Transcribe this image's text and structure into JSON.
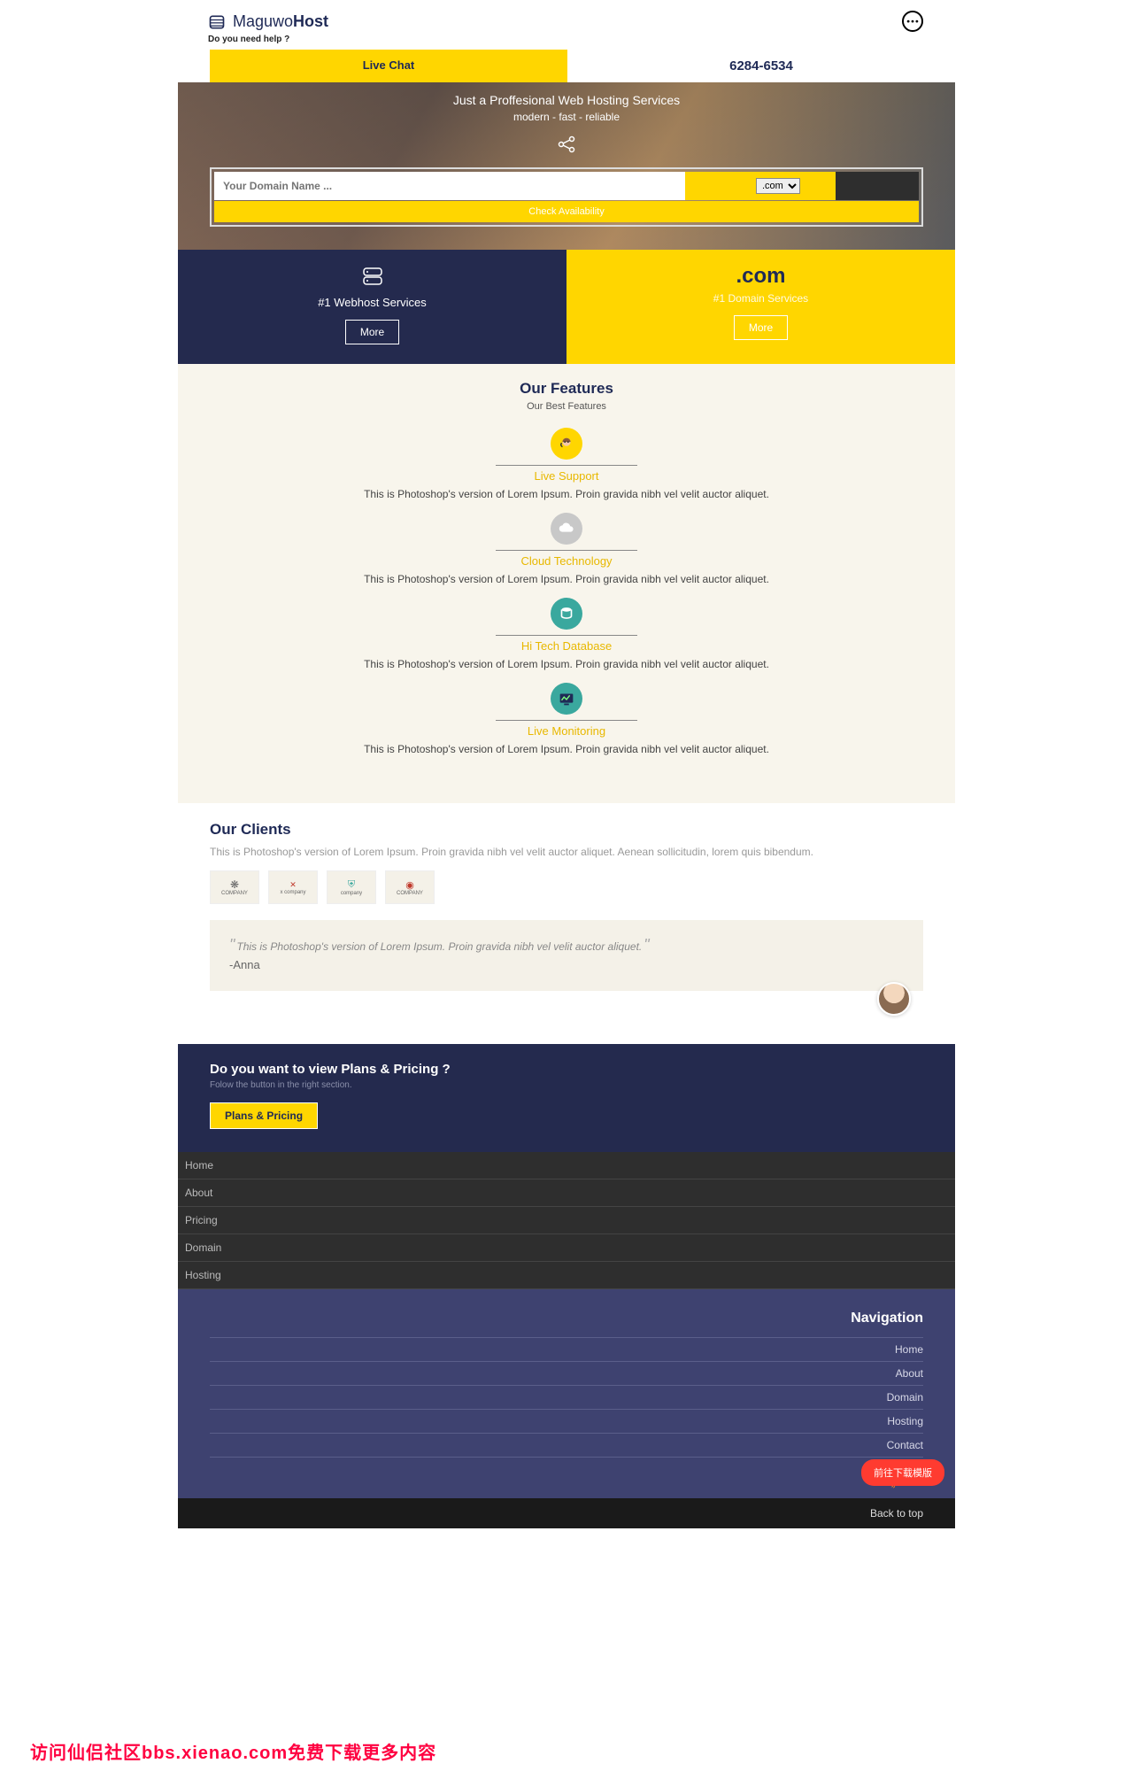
{
  "brand": {
    "prefix": "Maguwo",
    "suffix": "Host"
  },
  "help": "Do you need help ?",
  "livechat": "Live Chat",
  "phone": "6284-6534",
  "hero": {
    "title": "Just a Proffesional Web Hosting Services",
    "sub": "modern - fast - reliable",
    "placeholder": "Your Domain Name ...",
    "tld": ".com",
    "check": "Check Availability"
  },
  "promo": {
    "p1": {
      "label": "#1 Webhost Services",
      "btn": "More"
    },
    "p2": {
      "big": ".com",
      "label": "#1 Domain Services",
      "btn": "More"
    }
  },
  "features": {
    "title": "Our Features",
    "sub": "Our Best Features",
    "items": [
      {
        "title": "Live Support",
        "desc": "This is Photoshop's version of Lorem Ipsum. Proin gravida nibh vel velit auctor aliquet."
      },
      {
        "title": "Cloud Technology",
        "desc": "This is Photoshop's version of Lorem Ipsum. Proin gravida nibh vel velit auctor aliquet."
      },
      {
        "title": "Hi Tech Database",
        "desc": "This is Photoshop's version of Lorem Ipsum. Proin gravida nibh vel velit auctor aliquet."
      },
      {
        "title": "Live Monitoring",
        "desc": "This is Photoshop's version of Lorem Ipsum. Proin gravida nibh vel velit auctor aliquet."
      }
    ]
  },
  "clients": {
    "title": "Our Clients",
    "sub": "This is Photoshop's version of Lorem Ipsum. Proin gravida nibh vel velit auctor aliquet. Aenean sollicitudin, lorem quis bibendum.",
    "logos": [
      "COMPANY",
      "x company",
      "company",
      "COMPANY"
    ],
    "quote": "This is Photoshop's version of Lorem Ipsum. Proin gravida nibh vel velit auctor aliquet.",
    "author": "-Anna"
  },
  "cta": {
    "title": "Do you want to view Plans & Pricing ?",
    "sub": "Folow the button in the right section.",
    "btn": "Plans & Pricing"
  },
  "footnav": [
    "Home",
    "About",
    "Pricing",
    "Domain",
    "Hosting"
  ],
  "footer": {
    "title": "Navigation",
    "links": [
      "Home",
      "About",
      "Domain",
      "Hosting",
      "Contact"
    ],
    "pill": "前往下载模版",
    "backtop": "Back to top"
  },
  "watermark": "访问仙侣社区bbs.xienao.com免费下载更多内容"
}
